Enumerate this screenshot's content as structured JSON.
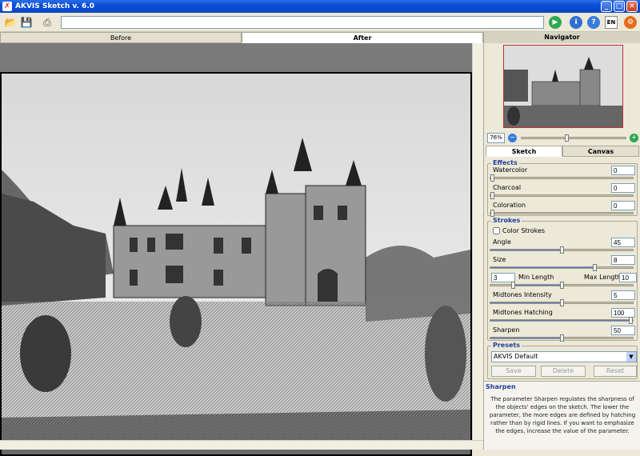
{
  "window": {
    "title": "AKVIS Sketch v. 6.0"
  },
  "toolbar": {
    "url_value": "",
    "lang_label": "EN"
  },
  "view_tabs": [
    "Before",
    "After"
  ],
  "navigator": {
    "title": "Navigator",
    "zoom": "76%",
    "zoom_fraction": 0.43
  },
  "panel_tabs": [
    "Sketch",
    "Canvas"
  ],
  "effects": {
    "title": "Effects",
    "params": [
      {
        "label": "Watercolor",
        "value": "0",
        "fraction": 0.0
      },
      {
        "label": "Charcoal",
        "value": "0",
        "fraction": 0.0
      },
      {
        "label": "Coloration",
        "value": "0",
        "fraction": 0.0
      }
    ]
  },
  "strokes": {
    "title": "Strokes",
    "color_strokes_label": "Color Strokes",
    "color_strokes_checked": false,
    "angle": {
      "label": "Angle",
      "value": "45",
      "fraction": 0.5
    },
    "size": {
      "label": "Size",
      "value": "8",
      "fraction": 0.73
    },
    "min_length": {
      "label": "Min Length",
      "value": "3"
    },
    "max_length": {
      "label": "Max Length",
      "value": "10"
    },
    "length_fractions": [
      0.16,
      0.5
    ],
    "midtones_intensity": {
      "label": "Midtones Intensity",
      "value": "5",
      "fraction": 0.5
    },
    "midtones_hatching": {
      "label": "Midtones Hatching",
      "value": "100",
      "fraction": 1.0
    },
    "sharpen": {
      "label": "Sharpen",
      "value": "50",
      "fraction": 0.5
    }
  },
  "presets": {
    "title": "Presets",
    "selected": "AKVIS Default",
    "buttons": [
      "Save",
      "Delete",
      "Reset"
    ]
  },
  "help": {
    "title": "Sharpen",
    "text": "The parameter Sharpen regulates the sharpness of the objects' edges on the sketch. The lower the parameter, the more edges are defined by hatching rather than by rigid lines. If you want to emphasize the edges, increase the value of the parameter."
  },
  "colors": {
    "titlebar": "#0a4ed8",
    "group_title": "#20409a",
    "accent_green": "#2fa84f",
    "accent_orange": "#e86a1a"
  }
}
